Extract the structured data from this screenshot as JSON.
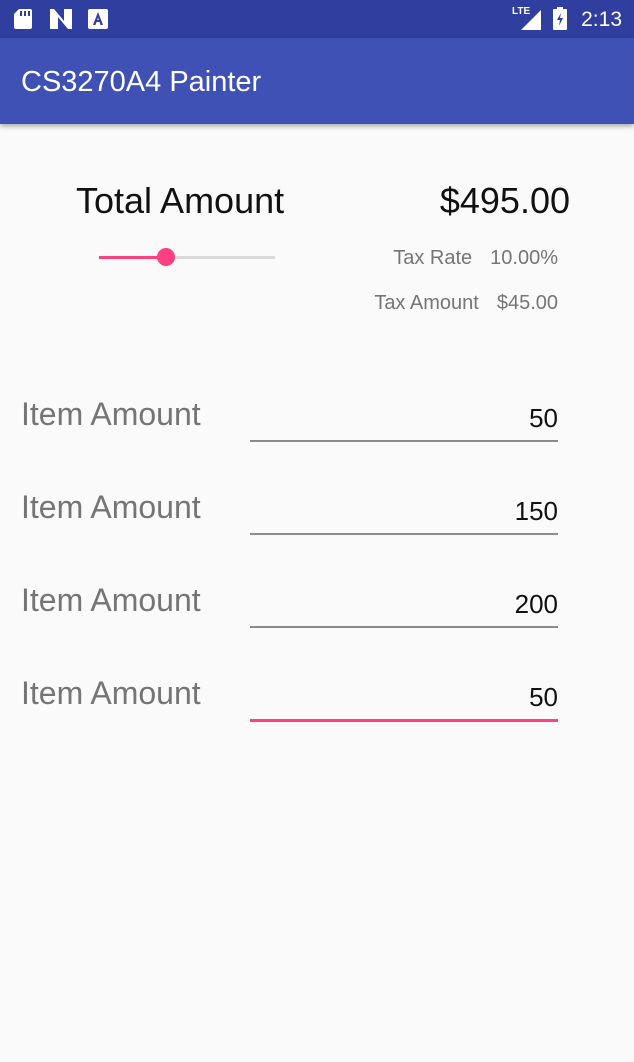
{
  "status_bar": {
    "time": "2:13",
    "network": "LTE",
    "icons": [
      "sd-card-icon",
      "n-notification-icon",
      "a-notification-icon",
      "signal-icon",
      "battery-icon"
    ]
  },
  "app_bar": {
    "title": "CS3270A4 Painter"
  },
  "summary": {
    "total_label": "Total Amount",
    "total_value": "$495.00",
    "tax_rate_label": "Tax Rate",
    "tax_rate_value": "10.00%",
    "tax_amount_label": "Tax Amount",
    "tax_amount_value": "$45.00",
    "tax_slider_fraction": 0.38
  },
  "items": [
    {
      "label": "Item Amount",
      "value": "50",
      "focused": false
    },
    {
      "label": "Item Amount",
      "value": "150",
      "focused": false
    },
    {
      "label": "Item Amount",
      "value": "200",
      "focused": false
    },
    {
      "label": "Item Amount",
      "value": "50",
      "focused": true
    }
  ],
  "colors": {
    "primary": "#3f51b5",
    "primary_dark": "#303f9f",
    "accent": "#ff4081"
  }
}
